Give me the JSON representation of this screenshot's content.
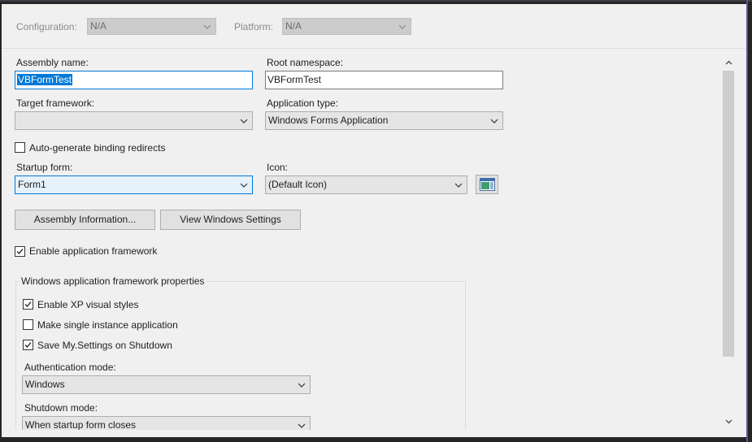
{
  "config_bar": {
    "configuration_label": "Configuration:",
    "configuration_value": "N/A",
    "platform_label": "Platform:",
    "platform_value": "N/A"
  },
  "assembly_name": {
    "label": "Assembly name:",
    "value": "VBFormTest"
  },
  "root_namespace": {
    "label": "Root namespace:",
    "value": "VBFormTest"
  },
  "target_framework": {
    "label": "Target framework:",
    "value": ""
  },
  "application_type": {
    "label": "Application type:",
    "value": "Windows Forms Application"
  },
  "auto_binding": {
    "label": "Auto-generate binding redirects",
    "checked": false
  },
  "startup_form": {
    "label": "Startup form:",
    "value": "Form1"
  },
  "icon": {
    "label": "Icon:",
    "value": "(Default Icon)"
  },
  "buttons": {
    "assembly_info": "Assembly Information...",
    "view_windows_settings": "View Windows Settings"
  },
  "enable_app_framework": {
    "label": "Enable application framework",
    "checked": true
  },
  "framework_group": {
    "title": "Windows application framework properties",
    "xp_styles": {
      "label": "Enable XP visual styles",
      "checked": true
    },
    "single_instance": {
      "label": "Make single instance application",
      "checked": false
    },
    "save_settings": {
      "label": "Save My.Settings on Shutdown",
      "checked": true
    },
    "auth_mode": {
      "label": "Authentication mode:",
      "value": "Windows"
    },
    "shutdown_mode": {
      "label": "Shutdown mode:",
      "value": "When startup form closes"
    }
  },
  "colors": {
    "panel_bg": "#f0f0f0",
    "focus_blue": "#0078d7",
    "outer_dark": "#252526"
  },
  "icons": {
    "dropdown": "chevron-down-icon",
    "check": "checkmark-icon",
    "scroll_up": "scroll-up-icon",
    "scroll_down": "scroll-down-icon",
    "app_icon": "default-app-icon"
  }
}
